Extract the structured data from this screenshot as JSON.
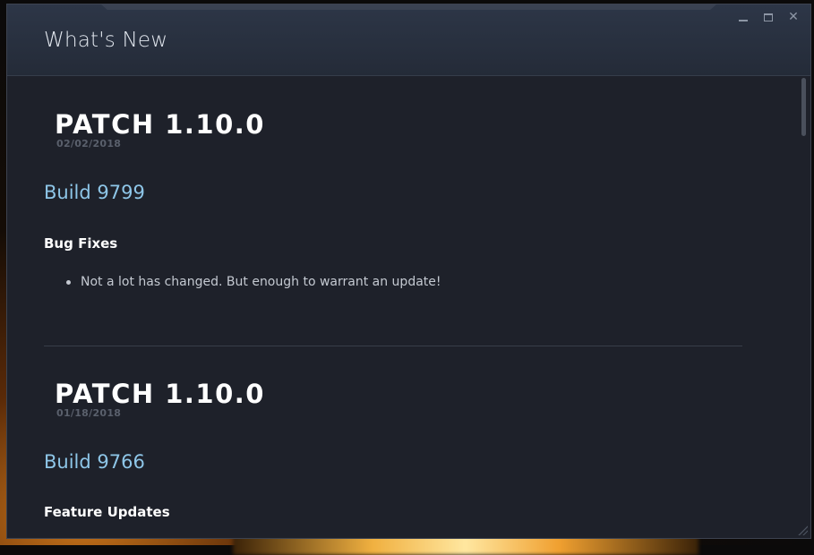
{
  "window": {
    "title": "What's New",
    "controls": [
      {
        "name": "minimize",
        "icon": "minimize-icon"
      },
      {
        "name": "maximize",
        "icon": "maximize-icon"
      },
      {
        "name": "close",
        "icon": "close-icon",
        "glyph": "✕"
      }
    ]
  },
  "patches": [
    {
      "title": "PATCH 1.10.0",
      "date": "02/02/2018",
      "build": "Build 9799",
      "sections": [
        {
          "heading": "Bug Fixes",
          "items": [
            "Not a lot has changed. But enough to warrant an update!"
          ]
        }
      ]
    },
    {
      "title": "PATCH 1.10.0",
      "date": "01/18/2018",
      "build": "Build 9766",
      "sections": [
        {
          "heading": "Feature Updates",
          "items": []
        }
      ]
    }
  ],
  "colors": {
    "window_bg": "#1e212a",
    "titlebar_bg": "#2a3342",
    "build_link": "#8ec6e8",
    "date_text": "#5a606c",
    "body_text": "#c4c9d1"
  }
}
